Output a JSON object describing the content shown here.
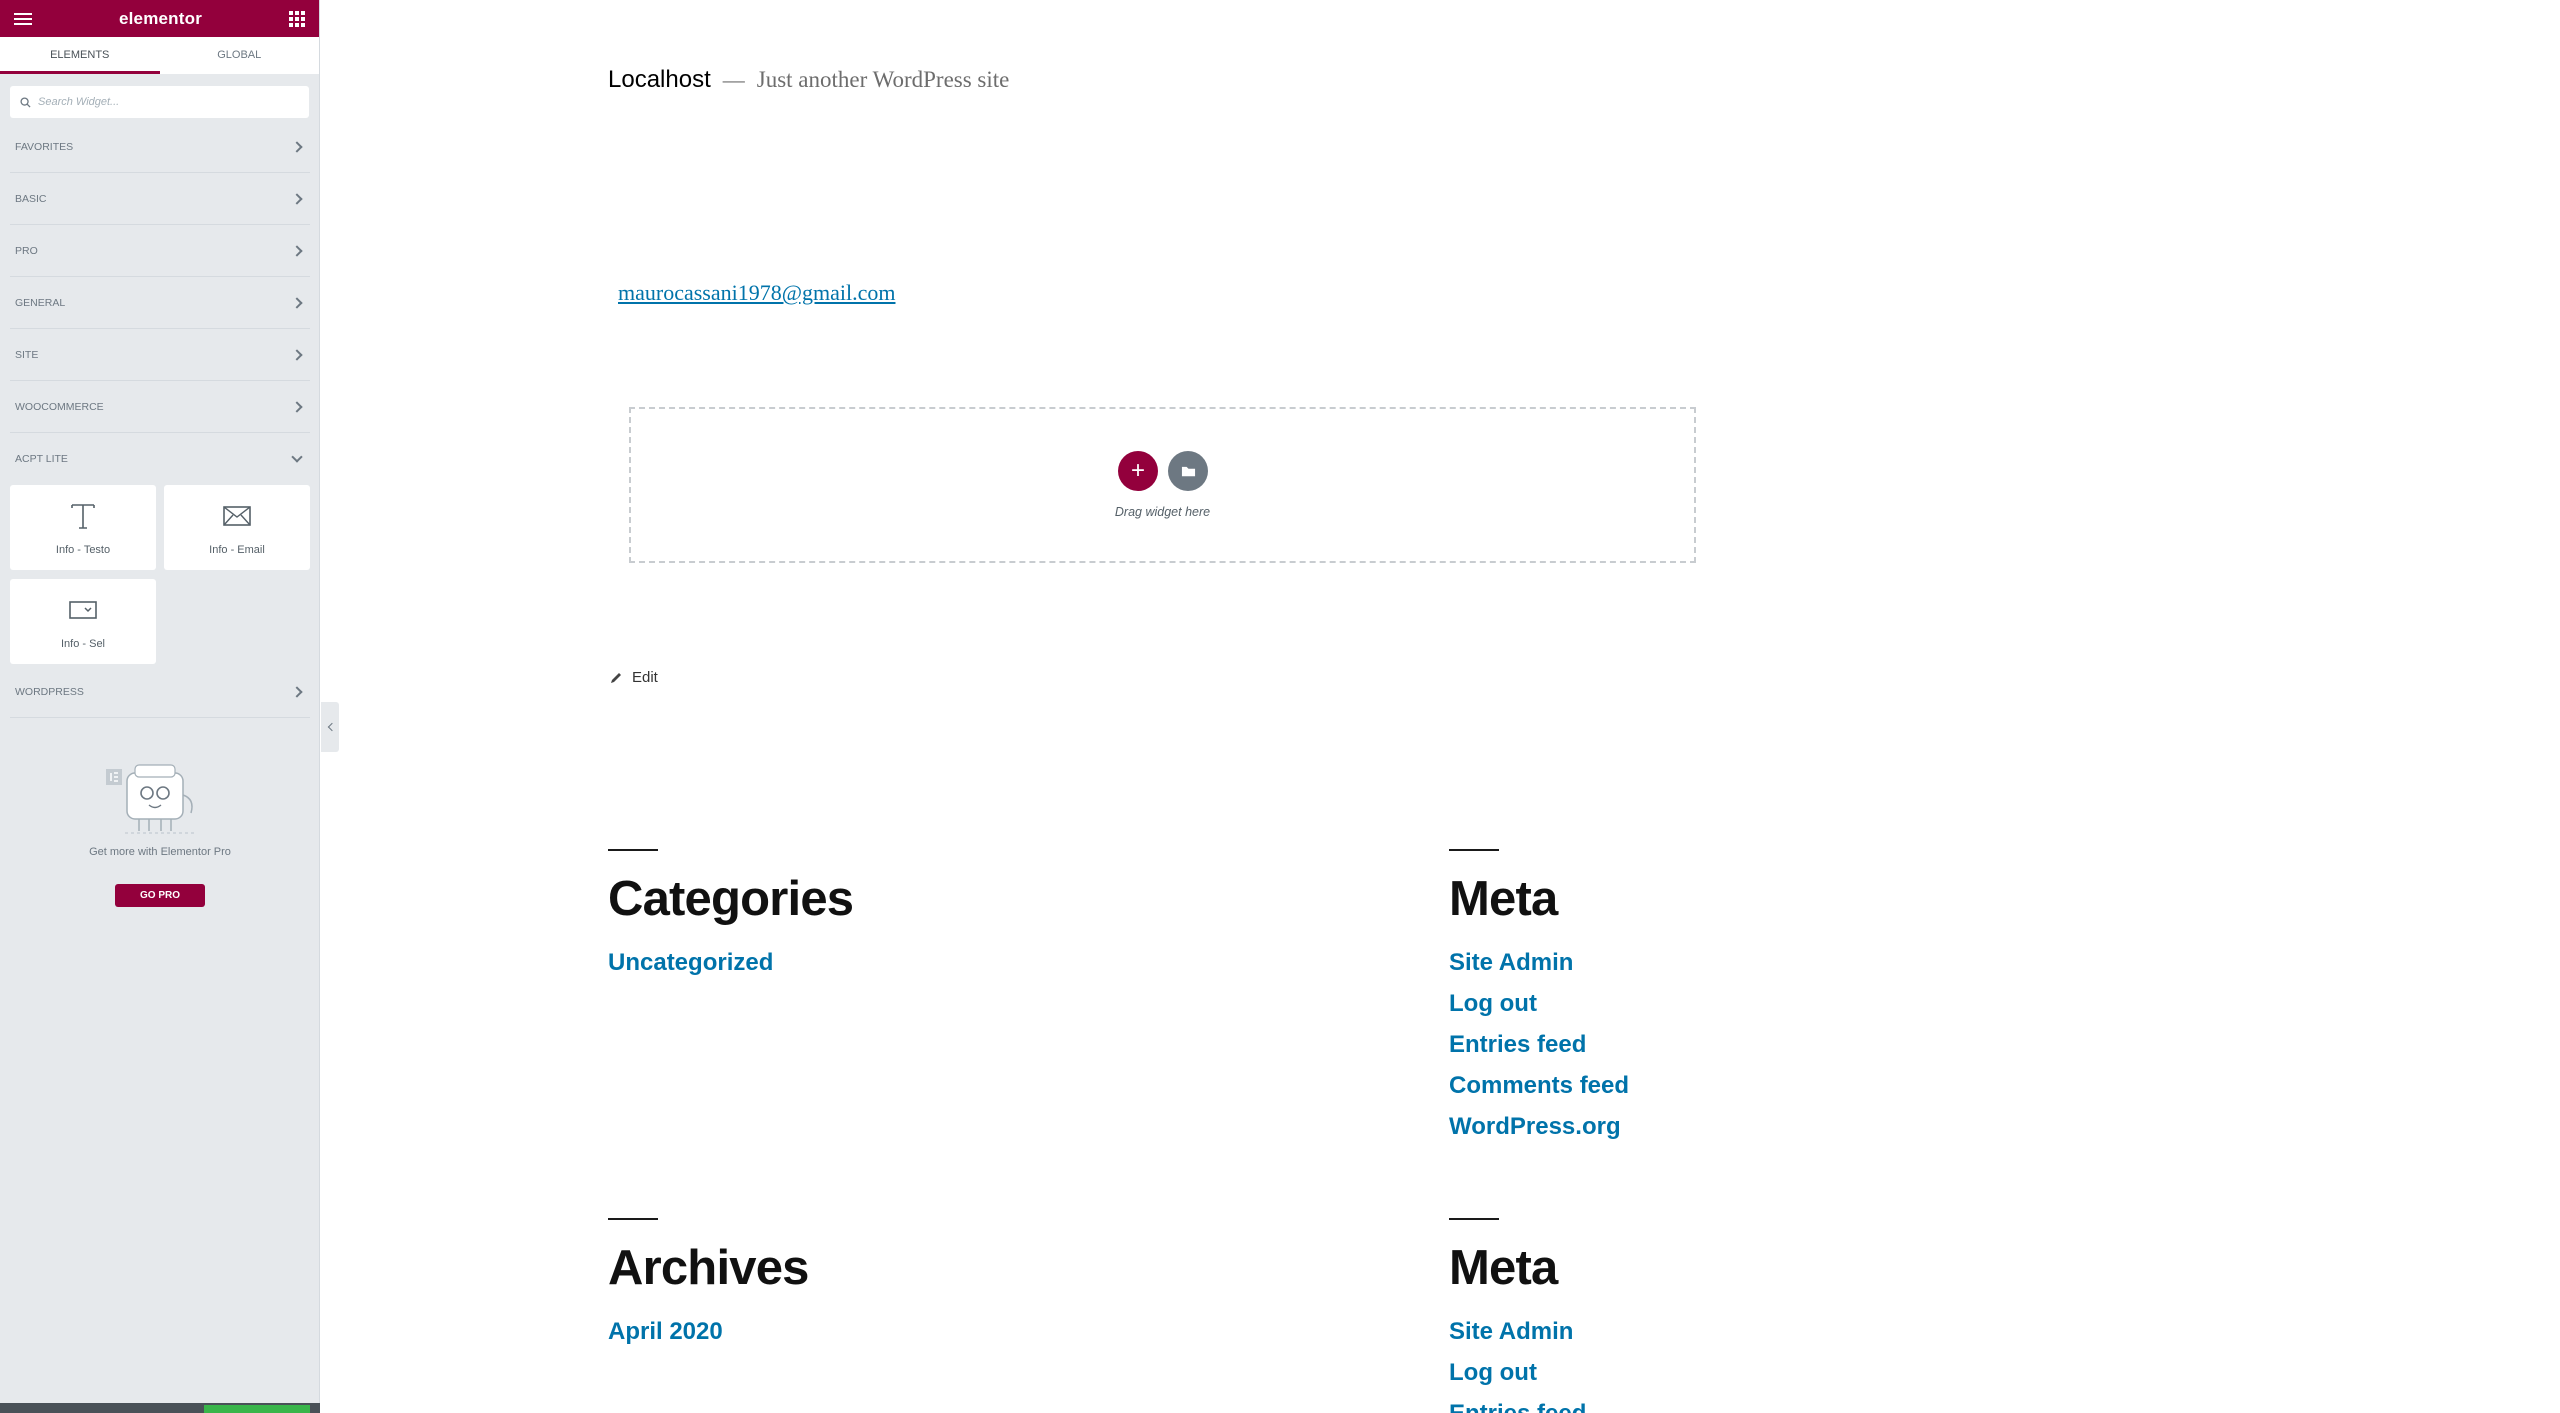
{
  "panel": {
    "logo": "elementor",
    "tabs": [
      "ELEMENTS",
      "GLOBAL"
    ],
    "search_placeholder": "Search Widget...",
    "categories": [
      "FAVORITES",
      "BASIC",
      "PRO",
      "GENERAL",
      "SITE",
      "WOOCOMMERCE",
      "ACPT LITE",
      "WORDPRESS"
    ],
    "expanded_category": "ACPT LITE",
    "widgets": [
      {
        "label": "Info - Testo",
        "icon": "text-icon"
      },
      {
        "label": "Info - Email",
        "icon": "envelope-icon"
      },
      {
        "label": "Info - Sel",
        "icon": "select-icon"
      }
    ],
    "promo_text": "Get more with Elementor Pro",
    "go_pro_label": "GO PRO"
  },
  "site": {
    "title": "Localhost",
    "separator": "—",
    "description": "Just another WordPress site",
    "email": "maurocassani1978@gmail.com",
    "drop_zone_text": "Drag widget here",
    "edit_label": "Edit"
  },
  "widgets_area": [
    {
      "heading": "Categories",
      "links": [
        "Uncategorized"
      ]
    },
    {
      "heading": "Meta",
      "links": [
        "Site Admin",
        "Log out",
        "Entries feed",
        "Comments feed",
        "WordPress.org"
      ]
    },
    {
      "heading": "Archives",
      "links": [
        "April 2020"
      ]
    },
    {
      "heading": "Meta",
      "links": [
        "Site Admin",
        "Log out",
        "Entries feed"
      ]
    }
  ],
  "colors": {
    "brand": "#93003c",
    "link": "#0073aa",
    "panel_bg": "#e6e9ec",
    "update_button": "#39b54a"
  }
}
